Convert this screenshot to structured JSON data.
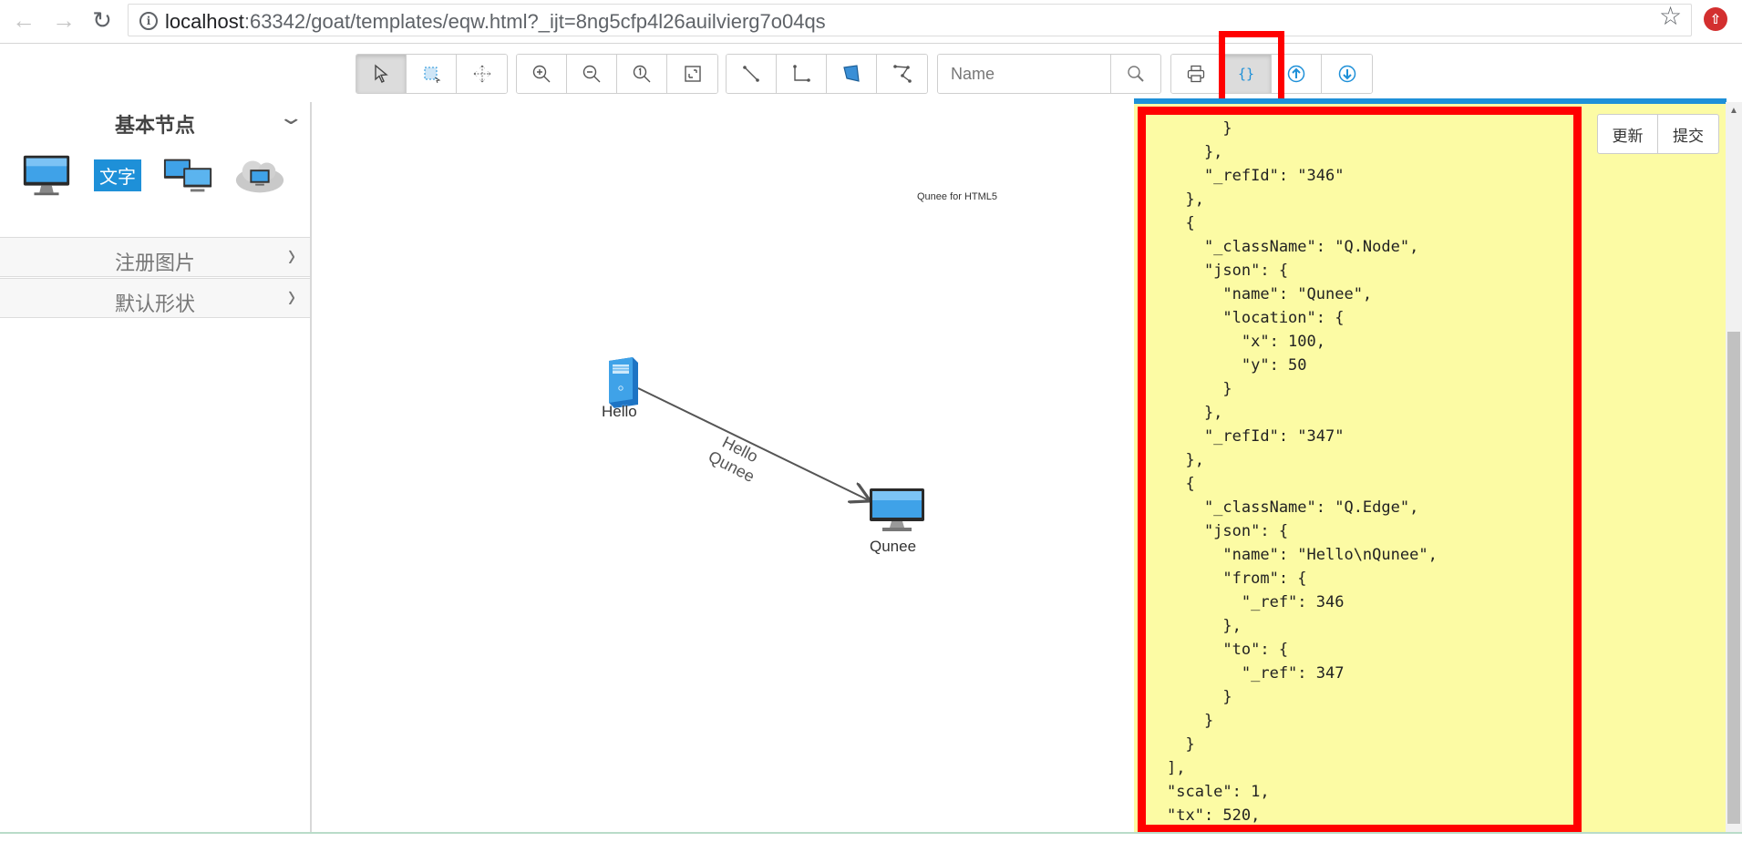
{
  "browser": {
    "url_host": "localhost",
    "url_path": ":63342/goat/templates/eqw.html?_ijt=8ng5cfp4l26auilvierg7o04qs"
  },
  "toolbar": {
    "search_placeholder": "Name",
    "groups": [
      [
        "select-icon",
        "rect-select-icon",
        "move-icon"
      ],
      [
        "zoom-in-icon",
        "zoom-out-icon",
        "zoom-reset-icon",
        "fit-icon"
      ],
      [
        "edge-line-icon",
        "edge-orthogonal-icon",
        "polygon-icon",
        "polyline-icon"
      ],
      [
        "print-icon",
        "json-icon",
        "export-icon",
        "import-icon"
      ]
    ],
    "active_buttons": [
      "select-icon",
      "json-icon"
    ]
  },
  "sidebar": {
    "title": "基本节点",
    "palette": {
      "text_node_label": "文字"
    },
    "sections": [
      {
        "label": "注册图片"
      },
      {
        "label": "默认形状"
      }
    ]
  },
  "canvas": {
    "watermark": "Qunee for HTML5",
    "nodes": {
      "hello": "Hello",
      "qunee": "Qunee"
    },
    "edge_label": "Hello\nQunee"
  },
  "json_panel": {
    "buttons": {
      "update": "更新",
      "submit": "提交"
    },
    "text": "      }\n    },\n    \"_refId\": \"346\"\n  },\n  {\n    \"_className\": \"Q.Node\",\n    \"json\": {\n      \"name\": \"Qunee\",\n      \"location\": {\n        \"x\": 100,\n        \"y\": 50\n      }\n    },\n    \"_refId\": \"347\"\n  },\n  {\n    \"_className\": \"Q.Edge\",\n    \"json\": {\n      \"name\": \"Hello\\nQunee\",\n      \"from\": {\n        \"_ref\": 346\n      },\n      \"to\": {\n        \"_ref\": 347\n      }\n    }\n  }\n],\n\"scale\": 1,\n\"tx\": 520,"
  },
  "colors": {
    "accent_blue": "#1e90d8",
    "highlight_red": "#ff0000",
    "json_background": "#fcfba4"
  }
}
